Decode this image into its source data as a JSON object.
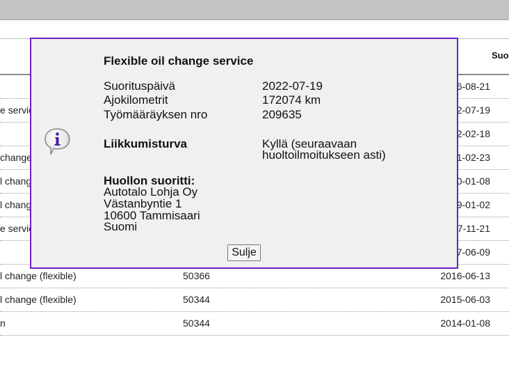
{
  "table": {
    "header": {
      "date_col": "Suo"
    },
    "rows": [
      {
        "name": "",
        "km": "",
        "date": "6-08-21"
      },
      {
        "name": "e servic",
        "km": "",
        "date": "2-07-19"
      },
      {
        "name": "",
        "km": "",
        "date": "2-02-18"
      },
      {
        "name": " change",
        "km": "",
        "date": "1-02-23"
      },
      {
        "name": "l chang",
        "km": "",
        "date": "0-01-08"
      },
      {
        "name": "l chang",
        "km": "",
        "date": "9-01-02"
      },
      {
        "name": "e servic",
        "km": "",
        "date": "7-11-21"
      },
      {
        "name": "",
        "km": "",
        "date": "7-06-09"
      },
      {
        "name": "l change (flexible)",
        "km": "50366",
        "date": "2016-06-13"
      },
      {
        "name": "l change (flexible)",
        "km": "50344",
        "date": "2015-06-03"
      },
      {
        "name": "n",
        "km": "50344",
        "date": "2014-01-08"
      }
    ]
  },
  "modal": {
    "title": "Flexible oil change service",
    "fields": {
      "date_label": "Suorituspäivä",
      "date_value": "2022-07-19",
      "km_label": "Ajokilometrit",
      "km_value": "172074 km",
      "order_label": "Työmääräyksen nro",
      "order_value": "209635"
    },
    "mobility": {
      "label": "Liikkumisturva",
      "value_line1": "Kyllä (seuraavaan",
      "value_line2": "huoltoilmoitukseen asti)"
    },
    "service_by": {
      "label": "Huollon suoritti:",
      "company": "Autotalo Lohja Oy",
      "street": "Västanbyntie 1",
      "city": "10600 Tammisaari",
      "country": "Suomi"
    },
    "close_label": "Sulje",
    "icon": "info-icon",
    "accent_color": "#6a1fc6"
  }
}
